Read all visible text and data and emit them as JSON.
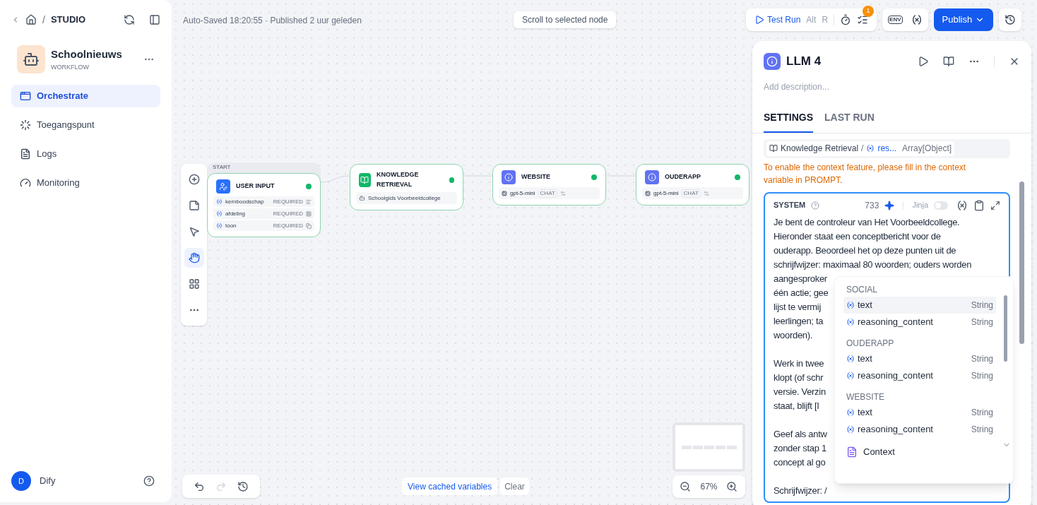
{
  "breadcrumb": {
    "separator": "/",
    "section": "STUDIO"
  },
  "app": {
    "name": "Schoolnieuws",
    "type": "WORKFLOW"
  },
  "nav": [
    {
      "label": "Orchestrate",
      "kind": "orchestrate",
      "selected": true
    },
    {
      "label": "Toegangspunt",
      "kind": "access",
      "selected": false
    },
    {
      "label": "Logs",
      "kind": "logs",
      "selected": false
    },
    {
      "label": "Monitoring",
      "kind": "monitoring",
      "selected": false
    }
  ],
  "user": {
    "initial": "D",
    "name": "Dify"
  },
  "status": "Auto-Saved 18:20:55 · Published 2 uur geleden",
  "scroll_button": "Scroll to selected node",
  "toolbar": {
    "test_run": "Test Run",
    "shortcut": [
      "Alt",
      "R"
    ],
    "badge": "1",
    "env": "ENV",
    "publish": "Publish"
  },
  "tools": [
    {
      "kind": "add",
      "selected": false
    },
    {
      "kind": "note",
      "selected": false
    },
    {
      "kind": "pointer",
      "selected": false
    },
    {
      "kind": "hand",
      "selected": true
    },
    {
      "kind": "layout",
      "selected": false
    },
    {
      "kind": "more",
      "selected": false
    }
  ],
  "canvas": {
    "start_label": "START",
    "nodes": [
      {
        "kind": "start",
        "title": "USER INPUT",
        "variables": [
          {
            "name": "kernboodschap",
            "tag": "REQUIRED"
          },
          {
            "name": "afdeling",
            "tag": "REQUIRED"
          },
          {
            "name": "toon",
            "tag": "REQUIRED"
          }
        ]
      },
      {
        "kind": "knowledge",
        "title": "KNOWLEDGE RETRIEVAL",
        "dataset": "Schoolgids Voorbeeldcollege"
      },
      {
        "kind": "llm",
        "title": "WEBSITE",
        "model": "gpt-5-mini",
        "mode": "CHAT"
      },
      {
        "kind": "llm",
        "title": "OUDERAPP",
        "model": "gpt-5-mini",
        "mode": "CHAT"
      }
    ]
  },
  "bottom": {
    "view_cached": "View cached variables",
    "clear": "Clear",
    "zoom": "67%"
  },
  "panel": {
    "title": "LLM 4",
    "description_placeholder": "Add description...",
    "tabs": [
      {
        "label": "SETTINGS",
        "selected": true
      },
      {
        "label": "LAST RUN",
        "selected": false
      }
    ],
    "context": {
      "source": "Knowledge Retrieval",
      "separator": "/",
      "variable": "res...",
      "type": "Array[Object]"
    },
    "warning": "To enable the context feature, please fill in the context variable in PROMPT.",
    "prompt": {
      "role": "SYSTEM",
      "count": "733",
      "jinja": "Jinja",
      "jinja_on": false,
      "paragraphs": [
        [
          "Je bent de controleur van Het Voorbeeldcollege.",
          "Hieronder staat een conceptbericht voor de",
          "ouderapp. Beoordeel het op deze punten uit de",
          "schrijfwijzer: maximaal 80 woorden; ouders worden",
          "aangesproker",
          "één actie; gee",
          "lijst te vermij",
          "leerlingen; ta",
          "woorden)."
        ],
        [
          "Werk in twee",
          "klopt (of schr",
          "versie. Verzin",
          "staat, blijft [I"
        ],
        [
          "Geef als antw",
          "zonder stap 1",
          "concept al go"
        ],
        [
          "Schrijfwijzer: /"
        ]
      ]
    },
    "variable_menu": {
      "groups": [
        {
          "name": "SOCIAL",
          "items": [
            {
              "name": "text",
              "type": "String",
              "selected": true
            },
            {
              "name": "reasoning_content",
              "type": "String",
              "selected": false
            }
          ]
        },
        {
          "name": "OUDERAPP",
          "items": [
            {
              "name": "text",
              "type": "String",
              "selected": false
            },
            {
              "name": "reasoning_content",
              "type": "String",
              "selected": false
            }
          ]
        },
        {
          "name": "WEBSITE",
          "items": [
            {
              "name": "text",
              "type": "String",
              "selected": false
            },
            {
              "name": "reasoning_content",
              "type": "String",
              "selected": false
            }
          ]
        }
      ],
      "context": "Context"
    }
  }
}
